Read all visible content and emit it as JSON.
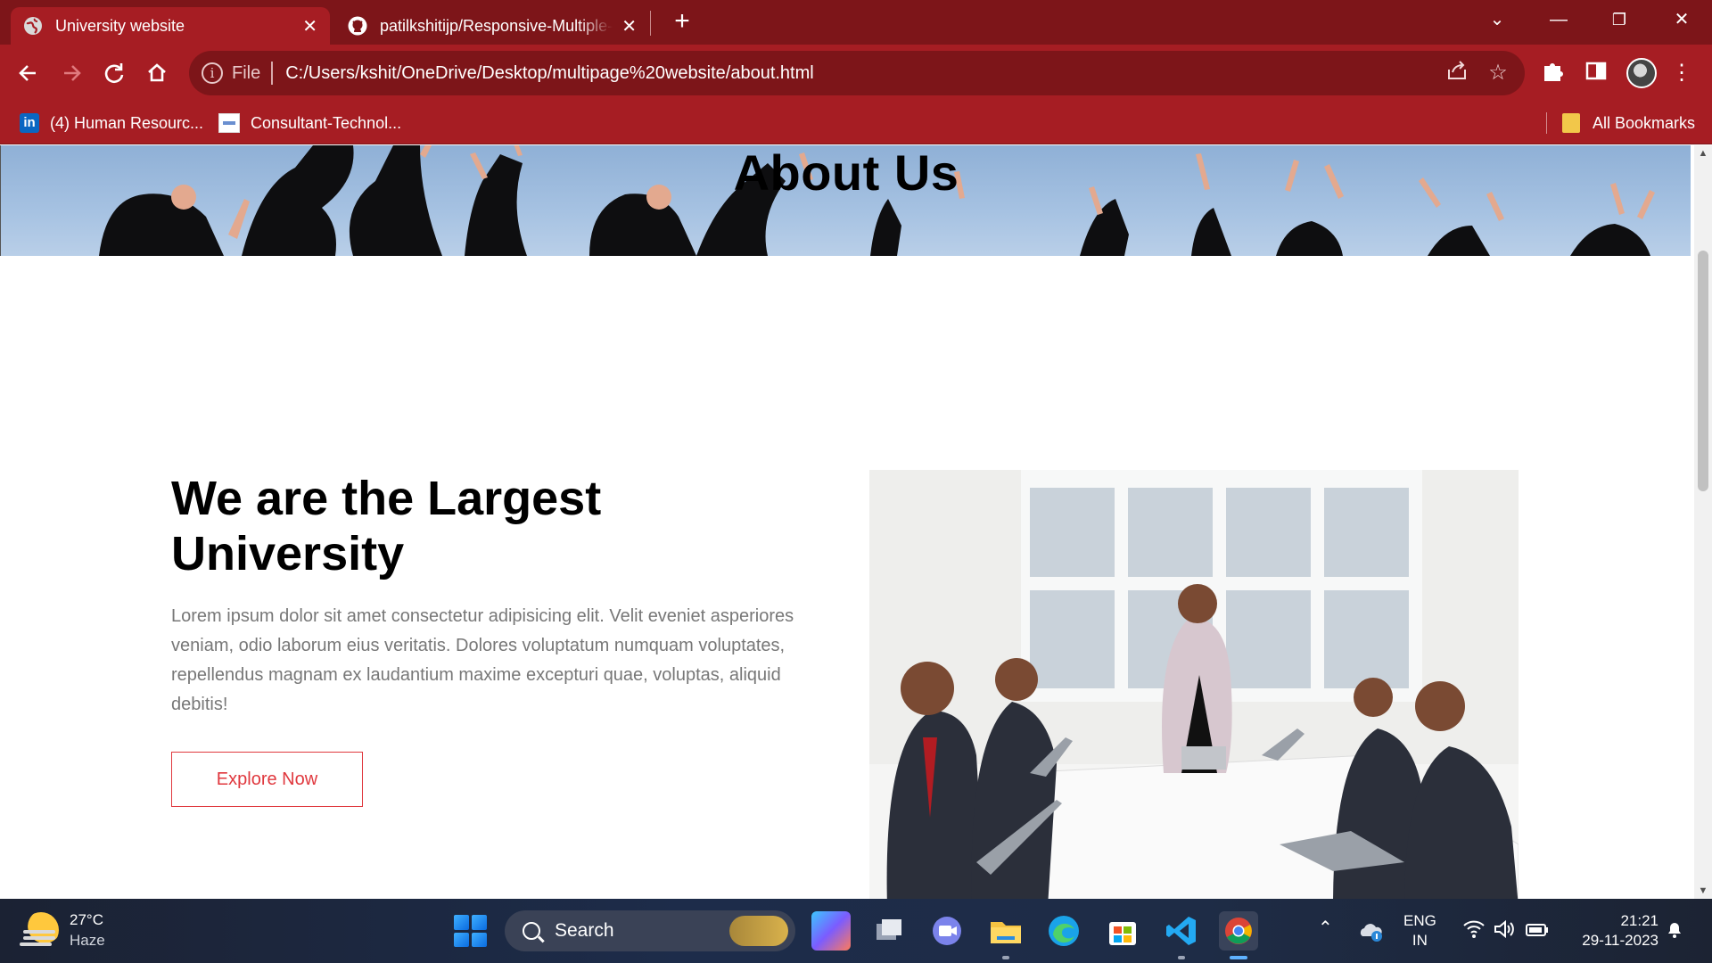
{
  "browser": {
    "tabs": [
      {
        "title": "University website",
        "favicon": "globe-icon",
        "active": true
      },
      {
        "title": "patilkshitijp/Responsive-Multiple-Page-Website",
        "favicon": "github-icon",
        "active": false
      }
    ],
    "address": {
      "scheme_label": "File",
      "url": "C:/Users/kshit/OneDrive/Desktop/multipage%20website/about.html"
    },
    "bookmarks": [
      {
        "label": "(4) Human Resourc...",
        "icon": "linkedin-icon"
      },
      {
        "label": "Consultant-Technol...",
        "icon": "doc-icon"
      }
    ],
    "all_bookmarks_label": "All Bookmarks",
    "theme_colors": {
      "frame": "#7d1519",
      "toolbar": "#a61d23"
    }
  },
  "page": {
    "hero_title": "About Us",
    "content": {
      "heading": "We are the Largest University",
      "paragraph": "Lorem ipsum dolor sit amet consectetur adipisicing elit. Velit eveniet asperiores veniam, odio laborum eius veritatis. Dolores voluptatum numquam voluptates, repellendus magnam ex laudantium maxime excepturi quae, voluptas, aliquid debitis!",
      "button_label": "Explore Now"
    },
    "accent_color": "#e0383e"
  },
  "taskbar": {
    "weather": {
      "temp": "27°C",
      "condition": "Haze"
    },
    "search_label": "Search",
    "language": {
      "line1": "ENG",
      "line2": "IN"
    },
    "clock": {
      "time": "21:21",
      "date": "29-11-2023"
    }
  }
}
